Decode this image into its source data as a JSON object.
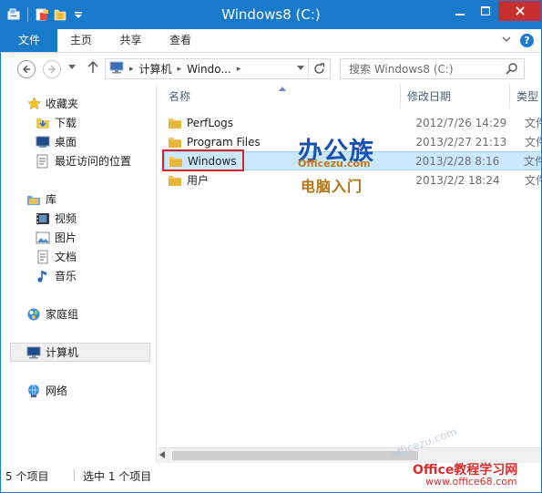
{
  "window": {
    "title": "Windows8 (C:)",
    "controls": [
      "minimize-icon",
      "maximize-icon",
      "close-icon"
    ]
  },
  "quick_access": {
    "icons": [
      "properties-icon",
      "new-folder-icon",
      "folder-icon",
      "customize-icon"
    ]
  },
  "ribbon": {
    "tabs": [
      {
        "label": "文件"
      },
      {
        "label": "主页"
      },
      {
        "label": "共享"
      },
      {
        "label": "查看"
      }
    ]
  },
  "address": {
    "breadcrumbs": [
      {
        "label": "计算机"
      },
      {
        "label": "Windo..."
      }
    ],
    "search_placeholder": "搜索 Windows8 (C:)"
  },
  "nav_pane": {
    "favorites": {
      "label": "收藏夹",
      "items": [
        {
          "label": "下载"
        },
        {
          "label": "桌面"
        },
        {
          "label": "最近访问的位置"
        }
      ]
    },
    "libraries": {
      "label": "库",
      "items": [
        {
          "label": "视频"
        },
        {
          "label": "图片"
        },
        {
          "label": "文档"
        },
        {
          "label": "音乐"
        }
      ]
    },
    "homegroup": {
      "label": "家庭组"
    },
    "computer": {
      "label": "计算机"
    },
    "network": {
      "label": "网络"
    }
  },
  "file_list": {
    "columns": [
      {
        "label": "名称"
      },
      {
        "label": "修改日期"
      },
      {
        "label": "类型"
      }
    ],
    "rows": [
      {
        "name": "PerfLogs",
        "modified": "2012/7/26 14:29",
        "type": "文件"
      },
      {
        "name": "Program Files",
        "modified": "2013/2/27 21:13",
        "type": "文件"
      },
      {
        "name": "Windows",
        "modified": "2013/2/28 8:16",
        "type": "文件",
        "selected": true
      },
      {
        "name": "用户",
        "modified": "2013/2/2 18:24",
        "type": "文件"
      }
    ]
  },
  "status_bar": {
    "item_count": "5 个项目",
    "selected_count": "选中 1 个项目"
  },
  "watermark": {
    "brand": "办公族",
    "domain": "Officezu.com",
    "tagline": "电脑入门",
    "bottom_brand": "Office教程学习网",
    "bottom_url": "www.office68.com",
    "faint": "officezu.com"
  },
  "colors": {
    "accent": "#1979ca",
    "close": "#c7302f",
    "selection": "#cce8ff",
    "highlight_box": "#d8232a"
  }
}
